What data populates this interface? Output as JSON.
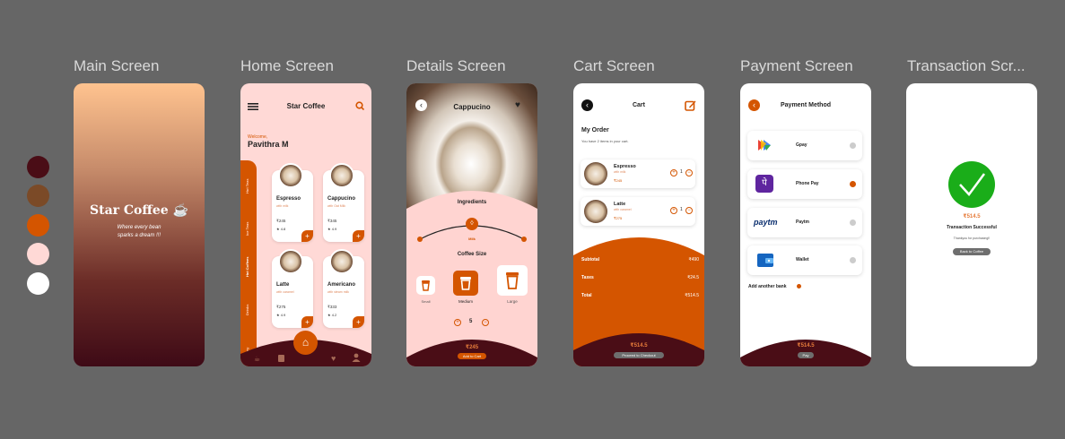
{
  "screen_titles": [
    "Main Screen",
    "Home Screen",
    "Details Screen",
    "Cart Screen",
    "Payment Screen",
    "Transaction Scr..."
  ],
  "palette": [
    "#4a0d16",
    "#7b4a27",
    "#d45500",
    "#ffd9d6",
    "#ffffff"
  ],
  "main": {
    "brand": "Star Coffee ☕",
    "tagline_1": "Where every bean",
    "tagline_2": "sparks a dream !!!"
  },
  "home": {
    "title": "Star Coffee",
    "welcome": "Welcome,",
    "user": "Pavithra M",
    "categories": [
      "Hot Teas",
      "Ice Teas",
      "Hot Coffees",
      "Drinks",
      "Bakery"
    ],
    "products": [
      {
        "name": "Espresso",
        "sub": "with milk",
        "price": "₹245",
        "rating": "★ 4.8"
      },
      {
        "name": "Cappucino",
        "sub": "with Oat Milk",
        "price": "₹345",
        "rating": "★ 4.9"
      },
      {
        "name": "Latte",
        "sub": "with caramel",
        "price": "₹275",
        "rating": "★ 4.9"
      },
      {
        "name": "Americano",
        "sub": "with steam milk",
        "price": "₹333",
        "rating": "★ 4.2"
      }
    ]
  },
  "details": {
    "title": "Cappucino",
    "ingredients": "Ingredients",
    "ingredient_label": "Milk",
    "size_title": "Coffee Size",
    "sizes": [
      "Small",
      "Medium",
      "Large"
    ],
    "qty": "5",
    "price": "₹245",
    "cta": "Add to Cart"
  },
  "cart": {
    "title": "Cart",
    "order_title": "My Order",
    "order_sub": "You have 2 items in your cart.",
    "items": [
      {
        "name": "Espresso",
        "sub": "with milk",
        "price": "₹245",
        "qty": "1"
      },
      {
        "name": "Latte",
        "sub": "with caramel",
        "price": "₹275",
        "qty": "1"
      }
    ],
    "subtotal_label": "Subtotal",
    "subtotal": "₹490",
    "taxes_label": "Taxes",
    "taxes": "₹24.5",
    "total_label": "Total",
    "total": "₹514.5",
    "footer_total": "₹514.5",
    "cta": "Proceed to Checkout"
  },
  "payment": {
    "title": "Payment Method",
    "methods": [
      {
        "name": "Gpay",
        "selected": false
      },
      {
        "name": "Phone Pay",
        "selected": true
      },
      {
        "name": "Paytm",
        "selected": false
      },
      {
        "name": "Wallet",
        "selected": false
      }
    ],
    "paytm_logo": "paytm",
    "add_bank": "Add another bank",
    "total": "₹514.5",
    "cta": "Pay"
  },
  "transaction": {
    "amount": "₹514.5",
    "status": "Transaction Successful",
    "thanks": "Thankyou for purchasing!!",
    "cta": "Back to Coffee"
  }
}
